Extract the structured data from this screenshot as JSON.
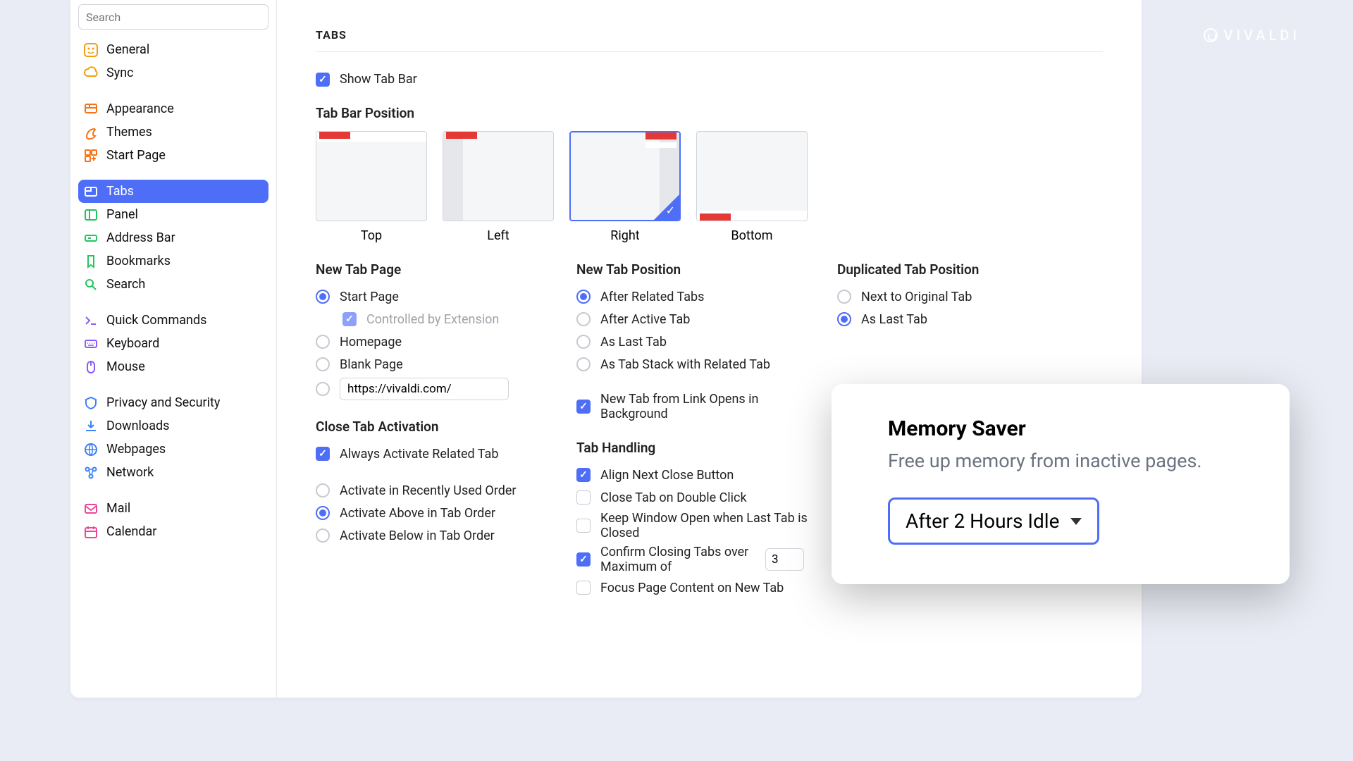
{
  "logo_text": "VIVALDI",
  "search_placeholder": "Search",
  "sidebar": {
    "general": "General",
    "sync": "Sync",
    "appearance": "Appearance",
    "themes": "Themes",
    "startpage": "Start Page",
    "tabs": "Tabs",
    "panel": "Panel",
    "addressbar": "Address Bar",
    "bookmarks": "Bookmarks",
    "search": "Search",
    "quick": "Quick Commands",
    "keyboard": "Keyboard",
    "mouse": "Mouse",
    "privacy": "Privacy and Security",
    "downloads": "Downloads",
    "webpages": "Webpages",
    "network": "Network",
    "mail": "Mail",
    "calendar": "Calendar"
  },
  "headings": {
    "section": "TABS",
    "position": "Tab Bar Position",
    "newtabpage": "New Tab Page",
    "newtabpos": "New Tab Position",
    "duptabpos": "Duplicated Tab Position",
    "closeactivation": "Close Tab Activation",
    "tabhandling": "Tab Handling"
  },
  "labels": {
    "showtabbar": "Show Tab Bar",
    "pos_top": "Top",
    "pos_left": "Left",
    "pos_right": "Right",
    "pos_bottom": "Bottom",
    "ntp_start": "Start Page",
    "ntp_ext": "Controlled by Extension",
    "ntp_home": "Homepage",
    "ntp_blank": "Blank Page",
    "ntp_url": "https://vivaldi.com/",
    "np_related": "After Related Tabs",
    "np_active": "After Active Tab",
    "np_last": "As Last Tab",
    "np_stack": "As Tab Stack with Related Tab",
    "np_bg": "New Tab from Link Opens in Background",
    "dp_next": "Next to Original Tab",
    "dp_last": "As Last Tab",
    "ca_always": "Always Activate Related Tab",
    "ca_recent": "Activate in Recently Used Order",
    "ca_above": "Activate Above in Tab Order",
    "ca_below": "Activate Below in Tab Order",
    "th_align": "Align Next Close Button",
    "th_dbl": "Close Tab on Double Click",
    "th_keep": "Keep Window Open when Last Tab is Closed",
    "th_confirm": "Confirm Closing Tabs over Maximum of",
    "th_confirm_val": "3",
    "th_focus": "Focus Page Content on New Tab"
  },
  "popup": {
    "title": "Memory Saver",
    "desc": "Free up memory from inactive pages.",
    "value": "After 2 Hours Idle"
  }
}
